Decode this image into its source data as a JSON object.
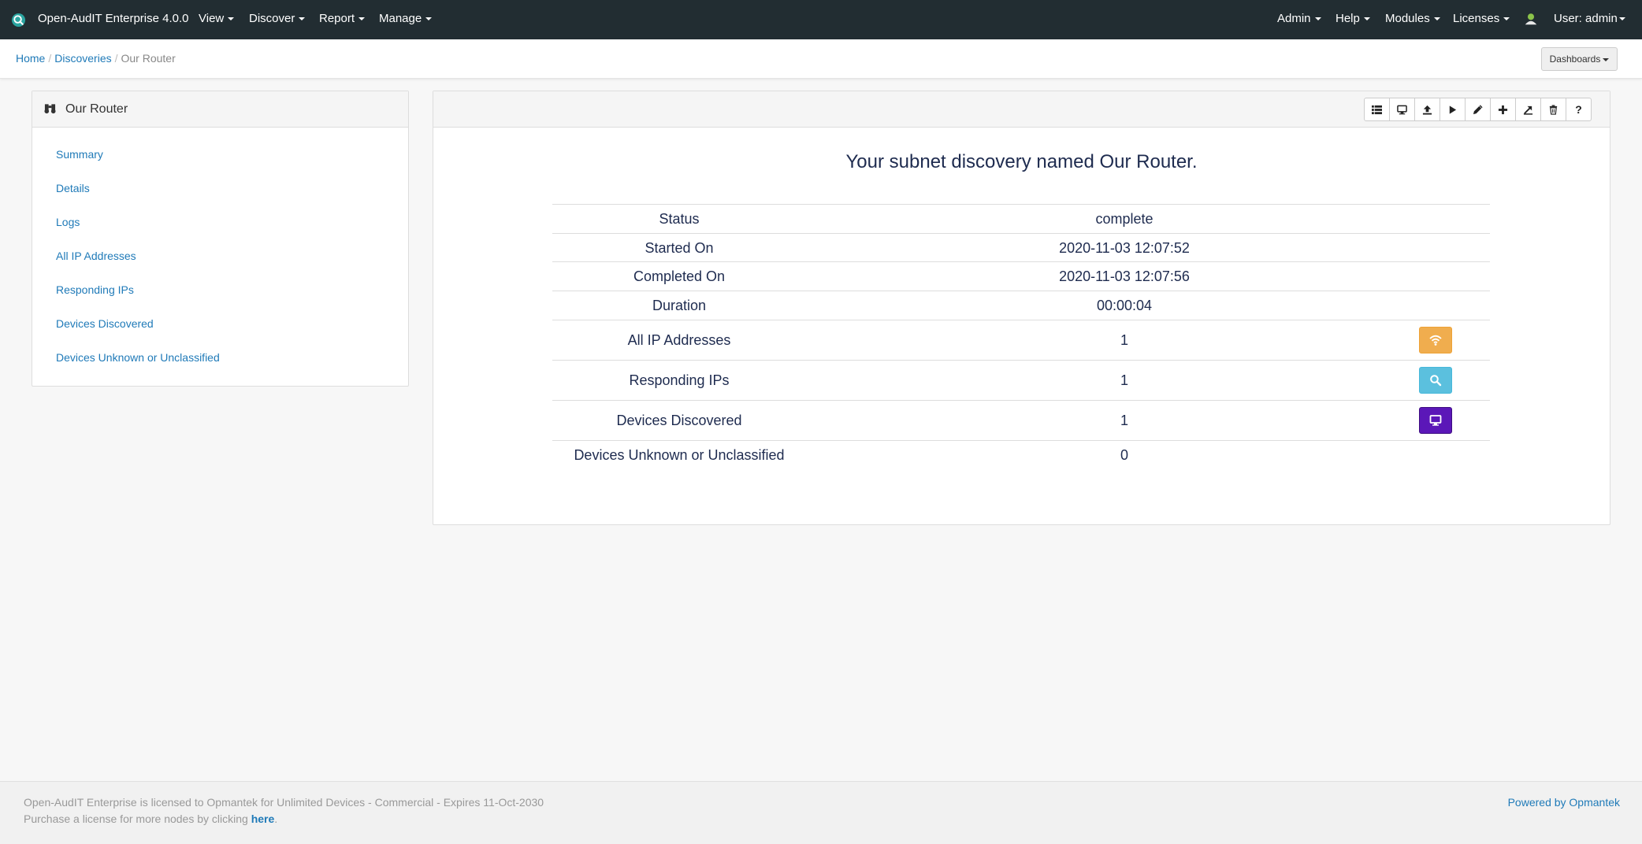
{
  "navbar": {
    "brand": "Open-AudIT Enterprise 4.0.0",
    "menus_left": [
      "View",
      "Discover",
      "Report",
      "Manage"
    ],
    "menus_right": [
      "Admin",
      "Help",
      "Modules",
      "Licenses"
    ],
    "user": "User: admin"
  },
  "breadcrumb": {
    "home": "Home",
    "discoveries": "Discoveries",
    "current": "Our Router"
  },
  "dashboards_button": "Dashboards",
  "sidebar": {
    "title": "Our Router",
    "links": [
      "Summary",
      "Details",
      "Logs",
      "All IP Addresses",
      "Responding IPs",
      "Devices Discovered",
      "Devices Unknown or Unclassified"
    ]
  },
  "toolbar": {
    "icons": [
      "list-icon",
      "desktop-icon",
      "upload-icon",
      "play-icon",
      "edit-icon",
      "plus-icon",
      "export-icon",
      "trash-icon",
      "help-icon"
    ]
  },
  "summary": {
    "headline": "Your subnet discovery named Our Router.",
    "rows": [
      {
        "label": "Status",
        "value": "complete"
      },
      {
        "label": "Started On",
        "value": "2020-11-03 12:07:52"
      },
      {
        "label": "Completed On",
        "value": "2020-11-03 12:07:56"
      },
      {
        "label": "Duration",
        "value": "00:00:04"
      },
      {
        "label": "All IP Addresses",
        "value": "1",
        "action": {
          "icon": "wifi-icon",
          "color": "#f0ad4e"
        }
      },
      {
        "label": "Responding IPs",
        "value": "1",
        "action": {
          "icon": "search-icon",
          "color": "#5bc0de"
        }
      },
      {
        "label": "Devices Discovered",
        "value": "1",
        "action": {
          "icon": "desktop-icon",
          "color": "#5b17b8"
        }
      },
      {
        "label": "Devices Unknown or Unclassified",
        "value": "0"
      }
    ]
  },
  "footer": {
    "line1": "Open-AudIT Enterprise is licensed to Opmantek for Unlimited Devices - Commercial - Expires 11-Oct-2030",
    "line2_prefix": "Purchase a license for more nodes by clicking ",
    "line2_link": "here",
    "line2_suffix": ".",
    "powered": "Powered by Opmantek"
  },
  "colors": {
    "navbar": "#222d32",
    "link": "#1f7ab8",
    "headline": "#1e2b4f"
  }
}
